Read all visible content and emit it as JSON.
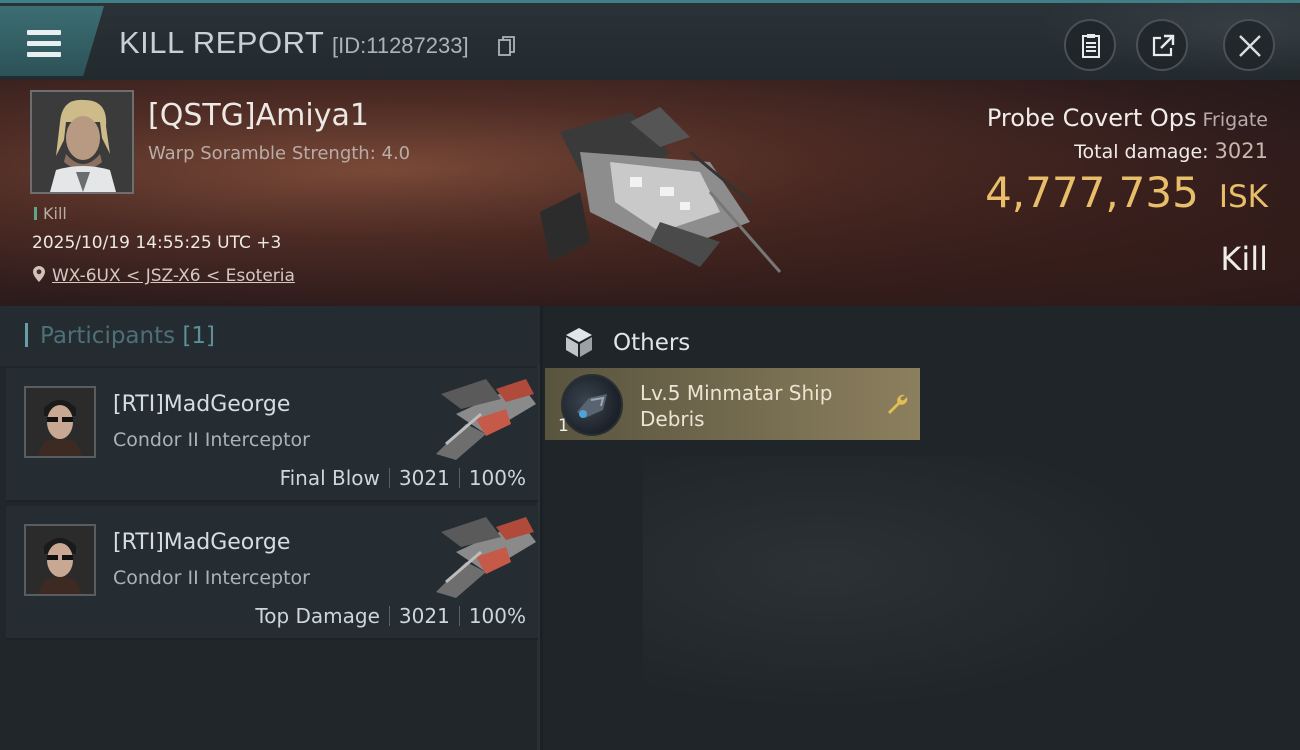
{
  "header": {
    "title": "KILL REPORT",
    "report_id": "[ID:11287233]"
  },
  "victim": {
    "name": "[QSTG]Amiya1",
    "subtitle": "Warp Soramble Strength: 4.0",
    "tag": "Kill",
    "timestamp": "2025/10/19 14:55:25 UTC +3",
    "location": "WX-6UX < JSZ-X6 < Esoteria",
    "ship_name": "Probe Covert Ops",
    "ship_class": "Frigate",
    "total_damage_label": "Total damage:",
    "total_damage": "3021",
    "isk_value": "4,777,735",
    "isk_unit": "ISK",
    "result": "Kill"
  },
  "participants": {
    "title": "Participants",
    "count": "[1]",
    "rows": [
      {
        "name": "[RTI]MadGeorge",
        "ship": "Condor II Interceptor",
        "role": "Final Blow",
        "damage": "3021",
        "percent": "100%"
      },
      {
        "name": "[RTI]MadGeorge",
        "ship": "Condor II Interceptor",
        "role": "Top Damage",
        "damage": "3021",
        "percent": "100%"
      }
    ]
  },
  "others": {
    "title": "Others",
    "items": [
      {
        "name": "Lv.5 Minmatar Ship Debris",
        "quantity": "1"
      }
    ]
  },
  "colors": {
    "accent_teal": "#3f7f86",
    "isk_gold": "#e8be6a",
    "item_card": "#8c7f5e"
  }
}
